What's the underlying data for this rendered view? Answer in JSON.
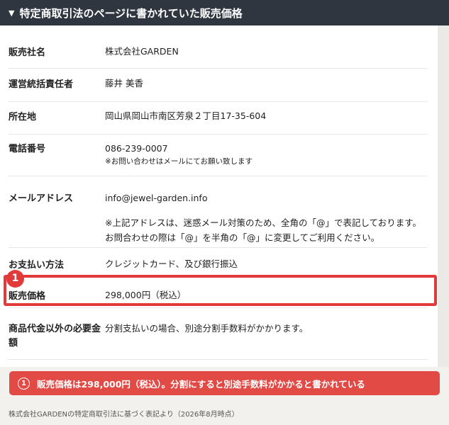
{
  "header": {
    "triangle": "▼",
    "title": "特定商取引法のページに書かれていた販売価格"
  },
  "rows": [
    {
      "label": "販売社名",
      "value": "株式会社GARDEN"
    },
    {
      "label": "運営統括責任者",
      "value": "藤井 美香"
    },
    {
      "label": "所在地",
      "value": "岡山県岡山市南区芳泉２丁目17-35-604"
    },
    {
      "label": "電話番号",
      "value": "086-239-0007",
      "note": "※お問い合わせはメールにてお願い致します"
    },
    {
      "label": "メールアドレス",
      "value": "info@jewel-garden.info",
      "para": "※上記アドレスは、迷惑メール対策のため、全角の「@」で表記しております。お問合わせの際は「@」を半角の「@」に変更してご利用ください。"
    },
    {
      "label": "お支払い方法",
      "value": "クレジットカード、及び銀行振込"
    },
    {
      "label": "販売価格",
      "value": "298,000円（税込）"
    },
    {
      "label": "商品代金以外の必要金額",
      "value": "分割支払いの場合、別途分割手数料がかかります。"
    }
  ],
  "badge": "1",
  "callout": {
    "number": "1",
    "text": "販売価格は298,000円（税込）。分割にすると別途手数料がかかると書かれている"
  },
  "footer": "株式会社GARDENの特定商取引法に基づく表記より（2026年8月時点）",
  "colors": {
    "header_bg": "#2f3640",
    "accent_red": "#e23a3a",
    "callout_bg": "#e24a46"
  }
}
